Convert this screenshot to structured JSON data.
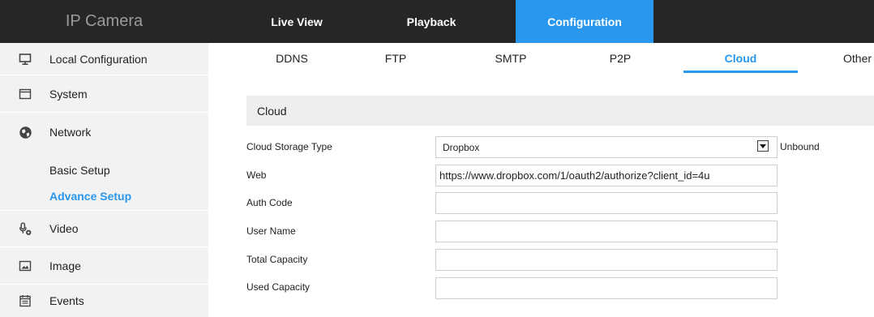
{
  "app": {
    "title": "IP Camera"
  },
  "topnav": [
    {
      "label": "Live View",
      "active": false
    },
    {
      "label": "Playback",
      "active": false
    },
    {
      "label": "Configuration",
      "active": true
    }
  ],
  "sidebar": {
    "items": [
      {
        "label": "Local Configuration",
        "icon": "monitor-icon"
      },
      {
        "label": "System",
        "icon": "system-window-icon"
      },
      {
        "label": "Network",
        "icon": "globe-icon"
      },
      {
        "label": "Video",
        "icon": "microphone-video-icon"
      },
      {
        "label": "Image",
        "icon": "image-icon"
      },
      {
        "label": "Events",
        "icon": "calendar-icon"
      }
    ],
    "network_subitems": [
      {
        "label": "Basic Setup",
        "active": false
      },
      {
        "label": "Advance Setup",
        "active": true
      }
    ]
  },
  "subtabs": [
    {
      "label": "DDNS",
      "active": false
    },
    {
      "label": "FTP",
      "active": false
    },
    {
      "label": "SMTP",
      "active": false
    },
    {
      "label": "P2P",
      "active": false
    },
    {
      "label": "Cloud",
      "active": true
    },
    {
      "label": "Other",
      "active": false
    }
  ],
  "section": {
    "title": "Cloud"
  },
  "form": {
    "cloud_storage_type": {
      "label": "Cloud Storage Type",
      "value": "Dropbox",
      "status": "Unbound"
    },
    "web": {
      "label": "Web",
      "value": "https://www.dropbox.com/1/oauth2/authorize?client_id=4u"
    },
    "auth_code": {
      "label": "Auth Code",
      "value": ""
    },
    "user_name": {
      "label": "User Name",
      "value": ""
    },
    "total_capacity": {
      "label": "Total Capacity",
      "value": ""
    },
    "used_capacity": {
      "label": "Used Capacity",
      "value": ""
    }
  },
  "colors": {
    "accent": "#2a97ee",
    "topbar": "#262626",
    "sidebar": "#f2f2f2"
  }
}
